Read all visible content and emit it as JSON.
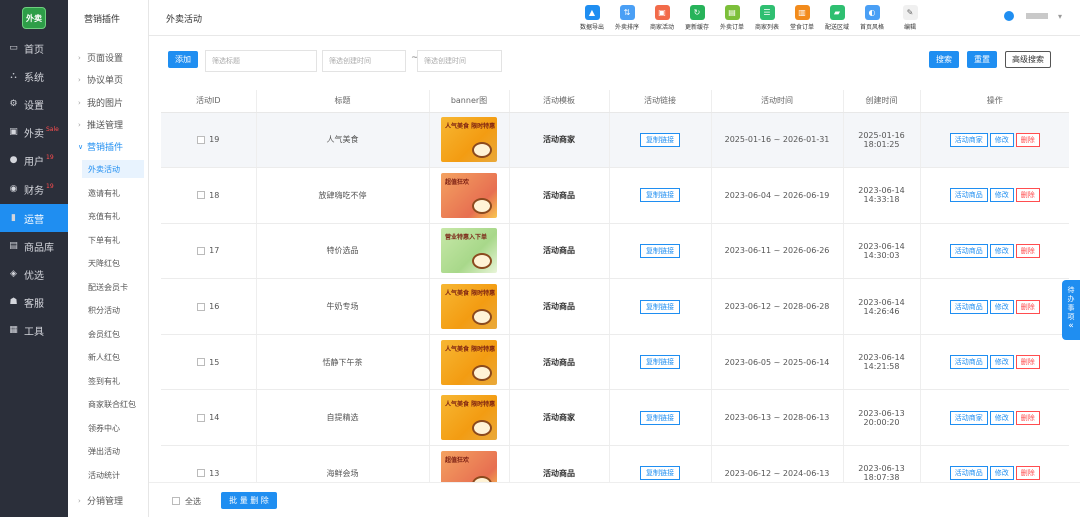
{
  "nav": {
    "logo": "外卖",
    "items": [
      {
        "label": "首页",
        "icon": "monitor-icon",
        "glyph": "▭",
        "badge": ""
      },
      {
        "label": "系统",
        "icon": "network-icon",
        "glyph": "⛬",
        "badge": ""
      },
      {
        "label": "设置",
        "icon": "gear-icon",
        "glyph": "⚙",
        "badge": ""
      },
      {
        "label": "外卖",
        "icon": "lock-icon",
        "glyph": "▣",
        "badge": "Sale"
      },
      {
        "label": "用户",
        "icon": "user-icon",
        "glyph": "●",
        "badge": "19"
      },
      {
        "label": "财务",
        "icon": "coin-icon",
        "glyph": "◉",
        "badge": "19"
      },
      {
        "label": "运营",
        "icon": "chart-bars-icon",
        "glyph": "▮",
        "badge": ""
      },
      {
        "label": "商品库",
        "icon": "box-icon",
        "glyph": "▤",
        "badge": ""
      },
      {
        "label": "优选",
        "icon": "compass-icon",
        "glyph": "◈",
        "badge": ""
      },
      {
        "label": "客服",
        "icon": "headset-icon",
        "glyph": "☗",
        "badge": ""
      },
      {
        "label": "工具",
        "icon": "toolbox-icon",
        "glyph": "▦",
        "badge": ""
      }
    ],
    "active_index": 6
  },
  "menu2": {
    "title": "营销插件",
    "groups": [
      "页面设置",
      "协议单页",
      "我的图片",
      "推送管理",
      "营销插件"
    ],
    "open_group": "营销插件",
    "sub_items": [
      "外卖活动",
      "邀请有礼",
      "充值有礼",
      "下单有礼",
      "天降红包",
      "配送会员卡",
      "积分活动",
      "会员红包",
      "新人红包",
      "签到有礼",
      "商家联合红包",
      "领券中心",
      "弹出活动",
      "活动统计"
    ],
    "active_sub": "外卖活动",
    "bottom_group": "分销管理"
  },
  "topbar": {
    "breadcrumb": "外卖活动",
    "tools": [
      {
        "label": "数据导出",
        "icon": "cloud-upload-icon",
        "color": "#1f8ef1",
        "glyph": "▲"
      },
      {
        "label": "外卖排序",
        "icon": "sort-icon",
        "color": "#4a9ff5",
        "glyph": "⇅"
      },
      {
        "label": "商家活动",
        "icon": "gift-icon",
        "color": "#f26b4a",
        "glyph": "▣"
      },
      {
        "label": "更新缓存",
        "icon": "refresh-icon",
        "color": "#27b35a",
        "glyph": "↻"
      },
      {
        "label": "外卖订单",
        "icon": "order-icon",
        "color": "#7cbf3a",
        "glyph": "▤"
      },
      {
        "label": "商家列表",
        "icon": "list-icon",
        "color": "#2fbf71",
        "glyph": "☰"
      },
      {
        "label": "堂食订单",
        "icon": "receipt-icon",
        "color": "#f28b1c",
        "glyph": "▥"
      },
      {
        "label": "配送区域",
        "icon": "truck-icon",
        "color": "#2fbf71",
        "glyph": "▰"
      },
      {
        "label": "首页风格",
        "icon": "palette-icon",
        "color": "#4a9ff5",
        "glyph": "◐"
      },
      {
        "label": "编辑",
        "icon": "edit-icon",
        "color": "#f0f0f0",
        "glyph": "✎"
      }
    ]
  },
  "filters": {
    "add_label": "添加",
    "title_placeholder": "筛选标题",
    "start_placeholder": "筛选创建时间",
    "tilde": "~",
    "end_placeholder": "筛选创建时间",
    "search_label": "搜索",
    "reset_label": "重置",
    "advanced_label": "高级搜索"
  },
  "table": {
    "headers": [
      "活动ID",
      "标题",
      "banner图",
      "活动模板",
      "活动链接",
      "活动时间",
      "创建时间",
      "操作"
    ],
    "copy_label": "复制链接",
    "edit_label": "修改",
    "delete_label": "删除",
    "rows": [
      {
        "id": "19",
        "title": "人气美食",
        "banner": "orange",
        "banner_text": "人气美食 限时特惠",
        "template": "活动商家",
        "time": "2025-01-16 ~ 2026-01-31",
        "created_date": "2025-01-16",
        "created_time": "18:01:25",
        "action": "活动商家"
      },
      {
        "id": "18",
        "title": "放肆嗨吃不停",
        "banner": "red",
        "banner_text": "超值狂欢",
        "template": "活动商品",
        "time": "2023-06-04 ~ 2026-06-19",
        "created_date": "2023-06-14",
        "created_time": "14:33:18",
        "action": "活动商品"
      },
      {
        "id": "17",
        "title": "特价选品",
        "banner": "green",
        "banner_text": "营业特惠入下单",
        "template": "活动商品",
        "time": "2023-06-11 ~ 2026-06-26",
        "created_date": "2023-06-14",
        "created_time": "14:30:03",
        "action": "活动商品"
      },
      {
        "id": "16",
        "title": "牛奶专场",
        "banner": "orange",
        "banner_text": "人气美食 限时特惠",
        "template": "活动商品",
        "time": "2023-06-12 ~ 2028-06-28",
        "created_date": "2023-06-14",
        "created_time": "14:26:46",
        "action": "活动商品"
      },
      {
        "id": "15",
        "title": "恬静下午茶",
        "banner": "orange",
        "banner_text": "人气美食 限时特惠",
        "template": "活动商品",
        "time": "2023-06-05 ~ 2025-06-14",
        "created_date": "2023-06-14",
        "created_time": "14:21:58",
        "action": "活动商品"
      },
      {
        "id": "14",
        "title": "自提精选",
        "banner": "orange",
        "banner_text": "人气美食 限时特惠",
        "template": "活动商家",
        "time": "2023-06-13 ~ 2028-06-13",
        "created_date": "2023-06-13",
        "created_time": "20:00:20",
        "action": "活动商家"
      },
      {
        "id": "13",
        "title": "海鲜会场",
        "banner": "red",
        "banner_text": "超值狂欢",
        "template": "活动商品",
        "time": "2023-06-12 ~ 2024-06-13",
        "created_date": "2023-06-13",
        "created_time": "18:07:38",
        "action": "活动商品"
      }
    ]
  },
  "footer": {
    "select_all_label": "全选",
    "batch_delete_label": "批 量 删 除"
  },
  "side_tab": {
    "label": "待办事项",
    "arrow": "«"
  }
}
